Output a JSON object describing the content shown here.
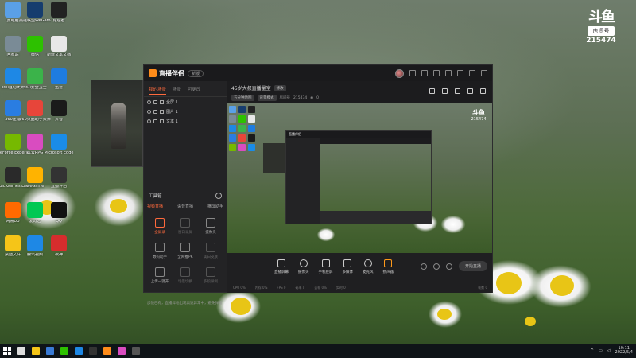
{
  "desktop": {
    "icons": [
      {
        "label": "此电脑",
        "color": "#5aa0e6"
      },
      {
        "label": "英雄联盟WeGame版",
        "color": "#163d6e"
      },
      {
        "label": "穿越者",
        "color": "#222"
      },
      {
        "label": "回收站",
        "color": "#7a8b96"
      },
      {
        "label": "微信",
        "color": "#2dc100"
      },
      {
        "label": "新建文本文档",
        "color": "#e8e8e8"
      },
      {
        "label": "360驱动大师",
        "color": "#1e88e5"
      },
      {
        "label": "360安全卫士",
        "color": "#3bb34a"
      },
      {
        "label": "迅雷",
        "color": "#1e7ce0"
      },
      {
        "label": "360压缩",
        "color": "#2a7de1"
      },
      {
        "label": "360桌面助手大师",
        "color": "#e7453a"
      },
      {
        "label": "抖音",
        "color": "#1a1a1a"
      },
      {
        "label": "GeForce Experience",
        "color": "#76b900"
      },
      {
        "label": "风云RPG",
        "color": "#d94cc0"
      },
      {
        "label": "Microsoft Edge",
        "color": "#1a8ce8"
      },
      {
        "label": "Epic Games Launcher",
        "color": "#2a2a2a"
      },
      {
        "label": "WeGame",
        "color": "#ffb300"
      },
      {
        "label": "直播伴侣",
        "color": "#333"
      },
      {
        "label": "网易UU",
        "color": "#ff6a00"
      },
      {
        "label": "爱奇艺",
        "color": "#00c853"
      },
      {
        "label": "QQ",
        "color": "#111"
      },
      {
        "label": "桌面文件",
        "color": "#f5c518"
      },
      {
        "label": "腾讯视频",
        "color": "#1e88e5"
      },
      {
        "label": "夜神",
        "color": "#d62d2d"
      }
    ]
  },
  "douyu": {
    "mark": "斗鱼",
    "room_label": "房间号",
    "room_number": "215474"
  },
  "app": {
    "title": "直播伴侣",
    "version": "新版",
    "left_tabs": [
      "我的场景",
      "场景",
      "可更改"
    ],
    "left_tab_plus": "+",
    "layers": [
      "全屏 1",
      "图片 1",
      "文本 1"
    ],
    "tools_header": "工具箱",
    "subtabs": [
      "视频直播",
      "语音直播",
      "横屏助手"
    ],
    "tools": [
      {
        "label": "全屏录",
        "state": "act"
      },
      {
        "label": "窗口录屏",
        "state": "dim"
      },
      {
        "label": "摄像头",
        "state": ""
      },
      {
        "label": "数码助手",
        "state": ""
      },
      {
        "label": "全网推PK",
        "state": ""
      },
      {
        "label": "美白皮肤",
        "state": "dim"
      },
      {
        "label": "上传一键开",
        "state": ""
      },
      {
        "label": "场景切换",
        "state": "dim"
      },
      {
        "label": "多段录制",
        "state": "dim"
      }
    ],
    "notice": "加快已有，直播异地出现高速异常中，避免弹窗",
    "stream_title": "45岁大叔直播量室",
    "stream_tag": "修改",
    "meta_chips": [
      "五分钟地图",
      "背景模式"
    ],
    "meta_label": "房间号",
    "room_number": "215474",
    "viewers": "0",
    "controls": [
      {
        "label": "直播屏幕",
        "orange": false,
        "round": false
      },
      {
        "label": "摄像头",
        "orange": false,
        "round": true
      },
      {
        "label": "手机投屏",
        "orange": false,
        "round": false
      },
      {
        "label": "多媒体",
        "orange": false,
        "round": false
      },
      {
        "label": "麦克风",
        "orange": false,
        "round": true
      },
      {
        "label": "扬声器",
        "orange": true,
        "round": false
      }
    ],
    "start_button": "开始直播",
    "stats": [
      "CPU 0%",
      "内存 0%",
      "FPS 0",
      "码率 0",
      "丢帧 0%",
      "实时 0"
    ],
    "stats_right": "帧数 0"
  },
  "preview": {
    "logo": "斗鱼",
    "room": "215474",
    "inner_title": "直播伴侣"
  },
  "taskbar": {
    "time": "10:11",
    "date": "2022/5/4"
  }
}
